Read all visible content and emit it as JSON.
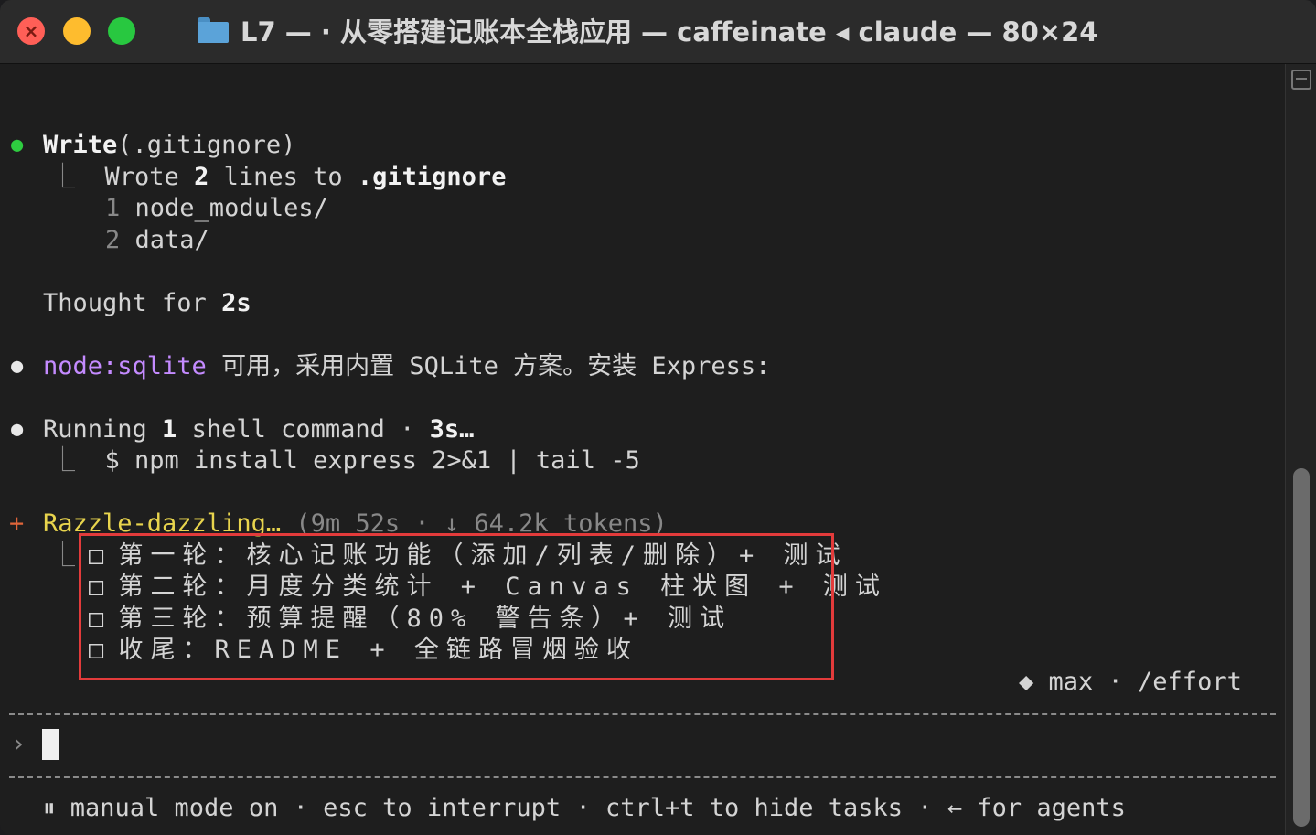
{
  "window": {
    "title": "L7 — ·  从零搭建记账本全栈应用 — caffeinate ◂ claude — 80×24"
  },
  "transcript": {
    "write_call": {
      "tool": "Write",
      "arg": "(.gitignore)"
    },
    "write_result": {
      "prefix": "Wrote ",
      "count": "2",
      "mid": " lines to ",
      "file": ".gitignore"
    },
    "file_lines": [
      {
        "num": "1",
        "text": "node_modules/"
      },
      {
        "num": "2",
        "text": "data/"
      }
    ],
    "thought": {
      "label": "Thought for ",
      "duration": "2s"
    },
    "message": {
      "code": "node:sqlite",
      "text": " 可用，采用内置 SQLite 方案。安装 Express:"
    },
    "running": {
      "prefix": "Running ",
      "count": "1",
      "mid": " shell command · ",
      "time": "3s…"
    },
    "command": "$ npm install express 2>&1 | tail -5",
    "spinner": {
      "glyph": "+",
      "label": "Razzle-dazzling…",
      "meta": " (9m 52s · ↓ 64.2k tokens)"
    },
    "tasks": [
      "第一轮：核心记账功能（添加/列表/删除）+ 测试",
      "第二轮：月度分类统计 + Canvas 柱状图 + 测试",
      "第三轮：预算提醒（80% 警告条）+ 测试",
      "收尾：README + 全链路冒烟验收"
    ],
    "task_checkbox": "□",
    "effort": "◆ max · /effort"
  },
  "prompt": {
    "symbol": "›",
    "value": ""
  },
  "status_bar": {
    "text": "⏸ manual mode on · esc to interrupt · ctrl+t to hide tasks · ← for agents"
  },
  "colors": {
    "success": "#2ecc40",
    "accent_purple": "#c48bff",
    "spinner_yellow": "#e8d44d",
    "highlight_red": "#e33b3b"
  }
}
